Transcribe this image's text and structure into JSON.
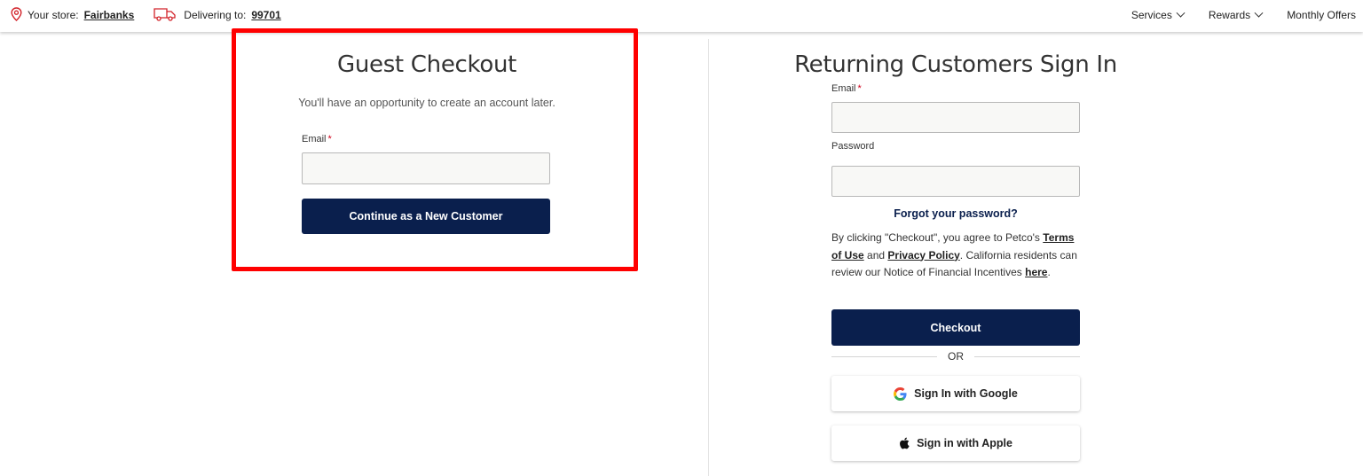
{
  "topbar": {
    "store_label": "Your store:",
    "store_name": "Fairbanks",
    "deliver_label": "Delivering to:",
    "zip": "99701",
    "nav": [
      {
        "label": "Services"
      },
      {
        "label": "Rewards"
      },
      {
        "label": "Monthly Offers"
      }
    ]
  },
  "guest": {
    "title": "Guest Checkout",
    "subtitle": "You'll have an opportunity to create an account later.",
    "email_label": "Email",
    "required_mark": "*",
    "email_value": "",
    "continue_label": "Continue as a New Customer"
  },
  "returning": {
    "title": "Returning Customers Sign In",
    "email_label": "Email",
    "required_mark": "*",
    "email_value": "",
    "password_label": "Password",
    "password_value": "",
    "forgot_label": "Forgot your password?",
    "legal_1": "By clicking \"Checkout\", you agree to Petco's",
    "terms_link": "Terms of Use",
    "legal_and": "and",
    "privacy_link": "Privacy Policy",
    "legal_2": ". California residents can review our Notice of Financial Incentives",
    "here_link": "here",
    "legal_end": ".",
    "checkout_label": "Checkout",
    "or_label": "OR",
    "google_label": "Sign In with Google",
    "apple_label": "Sign in with Apple"
  },
  "colors": {
    "primary": "#0a1f4d",
    "highlight": "#ff0000",
    "required": "#d0021b",
    "store_icon": "#d2232a"
  },
  "icons": {
    "store": "location-pin-icon",
    "delivery": "truck-icon",
    "nav_chevron": "chevron-down-icon",
    "google": "google-icon",
    "apple": "apple-icon"
  }
}
